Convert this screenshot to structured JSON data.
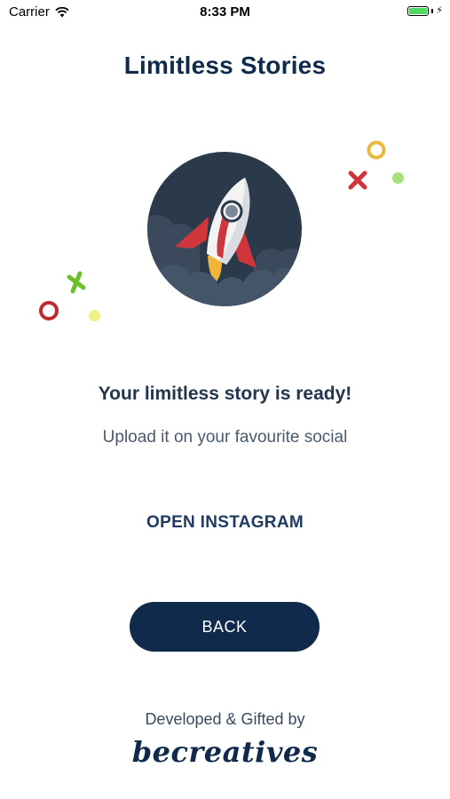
{
  "status_bar": {
    "carrier": "Carrier",
    "time": "8:33 PM",
    "battery_level": 1.0,
    "icons": [
      "wifi-icon",
      "battery-icon",
      "charging-bolt-icon"
    ]
  },
  "app": {
    "title": "Limitless Stories"
  },
  "illustration": {
    "icon": "rocket-icon",
    "background_color": "#2b3a4a",
    "decorations": [
      "ring-yellow",
      "cross-red",
      "dot-green",
      "cross-green",
      "ring-red",
      "dot-yellow"
    ]
  },
  "message": {
    "headline": "Your limitless story is ready!",
    "subline": "Upload it on your favourite social"
  },
  "actions": {
    "open_instagram": "OPEN INSTAGRAM",
    "back": "BACK"
  },
  "footer": {
    "credits": "Developed & Gifted by",
    "brand": "becreatives"
  },
  "colors": {
    "primary": "#0f2a4a",
    "accent_yellow": "#e8b93a",
    "accent_red": "#d0353b",
    "accent_green": "#6cc12b"
  }
}
